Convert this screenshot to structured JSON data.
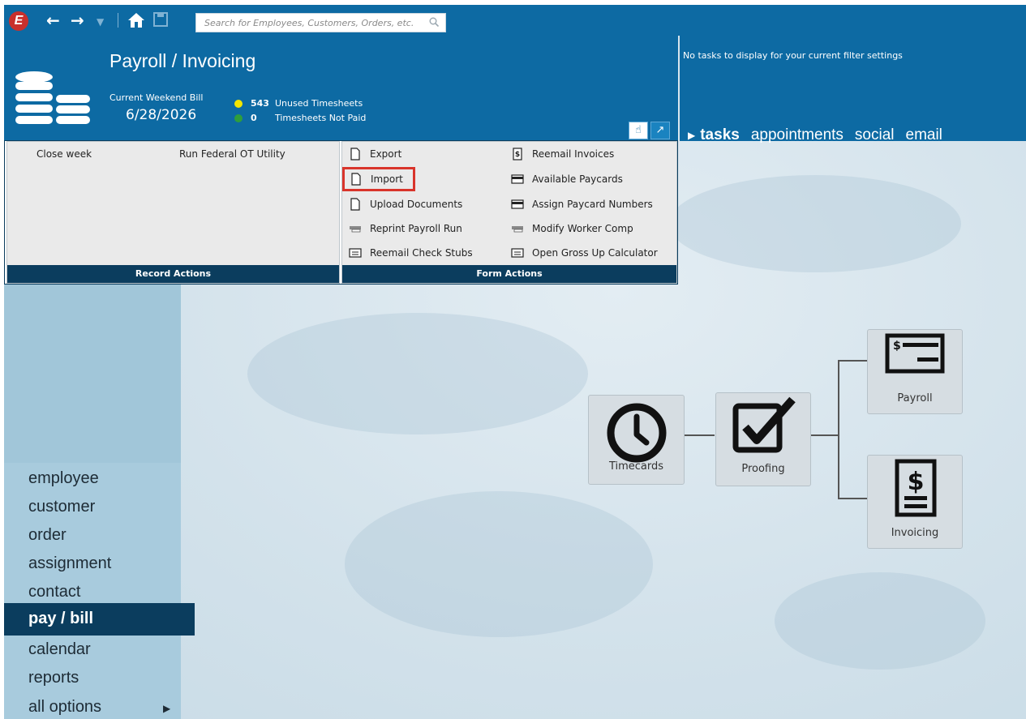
{
  "nav": {
    "logo_letter": "E",
    "search_placeholder": "Search for Employees, Customers, Orders, etc."
  },
  "header": {
    "title": "Payroll / Invoicing",
    "weekend_label": "Current Weekend Bill",
    "weekend_date": "6/28/2026",
    "stats": [
      {
        "count": "543",
        "label": "Unused Timesheets",
        "color": "#f2e600"
      },
      {
        "count": "0",
        "label": "Timesheets Not Paid",
        "color": "#2e9e3c"
      }
    ]
  },
  "tasks": {
    "message": "No tasks to display for your current filter settings",
    "tabs": [
      "tasks",
      "appointments",
      "social",
      "email"
    ]
  },
  "record_actions": {
    "title": "Record Actions",
    "items": [
      "Close week",
      "Run Federal OT Utility"
    ]
  },
  "form_actions": {
    "title": "Form Actions",
    "left": [
      {
        "label": "Export",
        "icon": "document-icon"
      },
      {
        "label": "Import",
        "icon": "document-icon"
      },
      {
        "label": "Upload Documents",
        "icon": "document-icon"
      },
      {
        "label": "Reprint Payroll Run",
        "icon": "printer-icon"
      },
      {
        "label": "Reemail Check Stubs",
        "icon": "check-stub-icon"
      }
    ],
    "right": [
      {
        "label": "Reemail Invoices",
        "icon": "invoice-icon"
      },
      {
        "label": "Available Paycards",
        "icon": "card-icon"
      },
      {
        "label": "Assign Paycard Numbers",
        "icon": "card-icon"
      },
      {
        "label": "Modify Worker Comp",
        "icon": "printer-icon"
      },
      {
        "label": "Open Gross Up Calculator",
        "icon": "check-stub-icon"
      }
    ]
  },
  "sidebar": {
    "items": [
      "employee",
      "customer",
      "order",
      "assignment",
      "contact",
      "pay / bill",
      "calendar",
      "reports",
      "all options"
    ],
    "active": "pay / bill"
  },
  "flow": {
    "timecards": "Timecards",
    "proofing": "Proofing",
    "payroll": "Payroll",
    "invoicing": "Invoicing"
  }
}
